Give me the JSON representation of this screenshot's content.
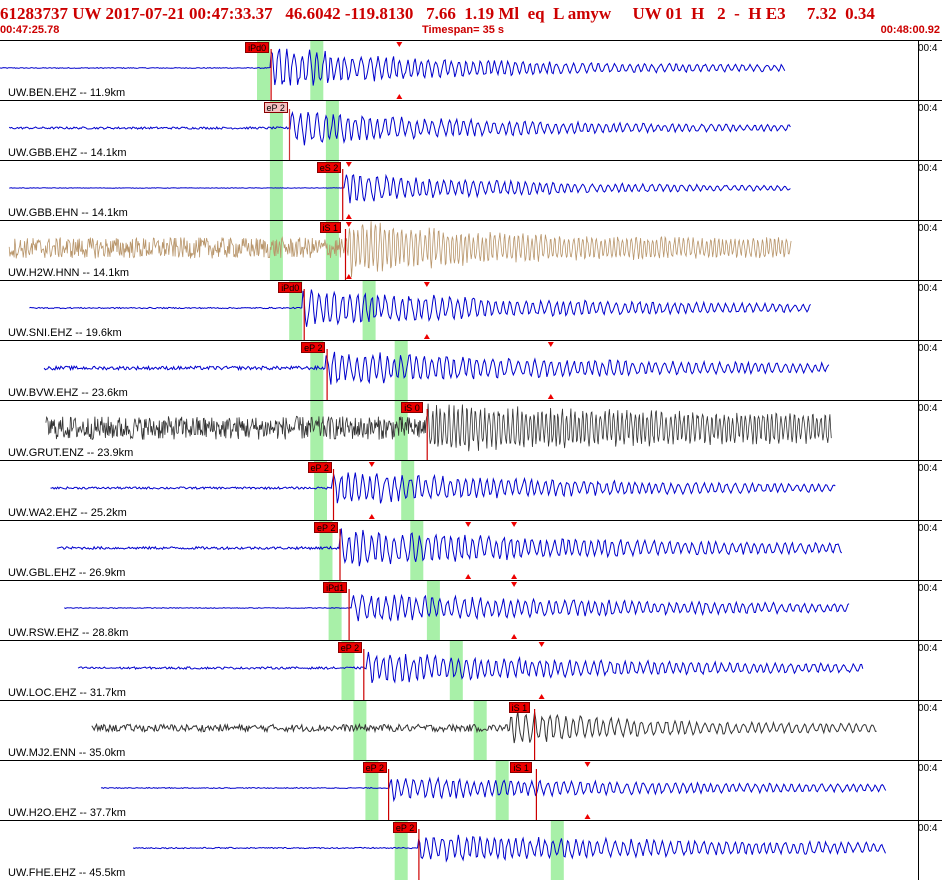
{
  "header": {
    "event_line": "61283737 UW 2017-07-21 00:47:33.37   46.6042 -119.8130   7.66  1.19 Ml  eq  L amyw     UW 01  H   2  -  H E3     7.32  0.34",
    "start_time": "00:47:25.78",
    "timespan": "Timespan=  35 s",
    "end_time": "00:48:00.92"
  },
  "colors": {
    "header_text": "#cc0000",
    "trace_blue": "#0000cc",
    "trace_tan": "#b8956a",
    "trace_gray": "#333333",
    "pick_red": "#ee0000",
    "pick_pale": "#f5c0c0",
    "window_green": "#a8f0a8"
  },
  "right_time_tag": "00:4",
  "channels": [
    {
      "label": "UW.BEN.EHZ -- 11.9km",
      "color": "blue",
      "gain": 0.85,
      "start": 0.0,
      "end": 0.855,
      "noise": 0.02,
      "onset": 0.295,
      "amp": 0.9,
      "decay": 0.35,
      "pick": {
        "text": "iPd0",
        "x": 0.267,
        "pale": false
      },
      "green": [
        0.28,
        0.338
      ],
      "markers": [
        0.435
      ]
    },
    {
      "label": "UW.GBB.EHZ -- 14.1km",
      "color": "blue",
      "gain": 0.7,
      "start": 0.01,
      "end": 0.862,
      "noise": 0.06,
      "onset": 0.316,
      "amp": 0.9,
      "decay": 0.4,
      "pick": {
        "text": "eP 2",
        "x": 0.287,
        "pale": true
      },
      "green": [
        0.294,
        0.355
      ],
      "markers": []
    },
    {
      "label": "UW.GBB.EHN -- 14.1km",
      "color": "blue",
      "gain": 0.6,
      "start": 0.01,
      "end": 0.862,
      "noise": 0.015,
      "onset": 0.376,
      "amp": 0.9,
      "decay": 0.4,
      "pick": {
        "text": "eS 2",
        "x": 0.345,
        "pale": false
      },
      "green": [
        0.294,
        0.355
      ],
      "markers": [
        0.38
      ]
    },
    {
      "label": "UW.H2W.HNN -- 14.1km",
      "color": "tan",
      "gain": 0.9,
      "start": 0.01,
      "end": 0.862,
      "noise": 0.45,
      "onset": 0.38,
      "amp": 0.95,
      "decay": 0.25,
      "pick": {
        "text": "iS 1",
        "x": 0.348,
        "pale": false
      },
      "green": [
        0.294,
        0.355
      ],
      "markers": [
        0.38
      ]
    },
    {
      "label": "UW.SNI.EHZ -- 19.6km",
      "color": "blue",
      "gain": 0.8,
      "start": 0.032,
      "end": 0.883,
      "noise": 0.03,
      "onset": 0.33,
      "amp": 0.9,
      "decay": 0.45,
      "pick": {
        "text": "iPd0",
        "x": 0.303,
        "pale": false
      },
      "green": [
        0.315,
        0.395
      ],
      "markers": [
        0.465
      ]
    },
    {
      "label": "UW.BVW.EHZ -- 23.6km",
      "color": "blue",
      "gain": 0.7,
      "start": 0.048,
      "end": 0.904,
      "noise": 0.1,
      "onset": 0.355,
      "amp": 0.9,
      "decay": 0.6,
      "pick": {
        "text": "eP 2",
        "x": 0.328,
        "pale": false
      },
      "green": [
        0.338,
        0.43
      ],
      "markers": [
        0.6
      ]
    },
    {
      "label": "UW.GRUT.ENZ -- 23.9km",
      "color": "gray",
      "gain": 0.9,
      "start": 0.05,
      "end": 0.906,
      "noise": 0.5,
      "onset": 0.465,
      "amp": 0.6,
      "decay": 0.8,
      "pick": {
        "text": "iS 0",
        "x": 0.437,
        "pale": false
      },
      "green": [
        0.338,
        0.43
      ],
      "markers": []
    },
    {
      "label": "UW.WA2.EHZ -- 25.2km",
      "color": "blue",
      "gain": 0.7,
      "start": 0.055,
      "end": 0.91,
      "noise": 0.06,
      "onset": 0.362,
      "amp": 0.9,
      "decay": 0.5,
      "pick": {
        "text": "eP 2",
        "x": 0.335,
        "pale": false
      },
      "green": [
        0.342,
        0.437
      ],
      "markers": [
        0.405
      ]
    },
    {
      "label": "UW.GBL.EHZ -- 26.9km",
      "color": "blue",
      "gain": 0.75,
      "start": 0.062,
      "end": 0.918,
      "noise": 0.07,
      "onset": 0.37,
      "amp": 0.95,
      "decay": 0.55,
      "pick": {
        "text": "eP 2",
        "x": 0.342,
        "pale": false
      },
      "green": [
        0.348,
        0.447
      ],
      "markers": [
        0.51,
        0.56
      ]
    },
    {
      "label": "UW.RSW.EHZ -- 28.8km",
      "color": "blue",
      "gain": 0.75,
      "start": 0.07,
      "end": 0.926,
      "noise": 0.02,
      "onset": 0.383,
      "amp": 0.7,
      "decay": 0.6,
      "pick": {
        "text": "iPd1",
        "x": 0.352,
        "pale": false
      },
      "green": [
        0.358,
        0.465
      ],
      "markers": [
        0.56
      ]
    },
    {
      "label": "UW.LOC.EHZ -- 31.7km",
      "color": "blue",
      "gain": 0.7,
      "start": 0.085,
      "end": 0.94,
      "noise": 0.06,
      "onset": 0.4,
      "amp": 0.8,
      "decay": 0.55,
      "pick": {
        "text": "eP 2",
        "x": 0.368,
        "pale": false
      },
      "green": [
        0.372,
        0.49
      ],
      "markers": [
        0.59
      ]
    },
    {
      "label": "UW.MJ2.ENN -- 35.0km",
      "color": "gray",
      "gain": 0.7,
      "start": 0.1,
      "end": 0.955,
      "noise": 0.2,
      "onset": 0.555,
      "amp": 0.85,
      "decay": 0.35,
      "pick": {
        "text": "iS 1",
        "x": 0.554,
        "pale": false
      },
      "green": [
        0.385,
        0.516
      ],
      "markers": []
    },
    {
      "label": "UW.H2O.EHZ -- 37.7km",
      "color": "blue",
      "gain": 0.6,
      "start": 0.11,
      "end": 0.965,
      "noise": 0.03,
      "onset": 0.425,
      "amp": 0.7,
      "decay": 0.6,
      "pick": {
        "text": "eP 2",
        "x": 0.395,
        "pale": false
      },
      "secondary": {
        "text": "iS 1",
        "x": 0.556
      },
      "green": [
        0.398,
        0.54
      ],
      "markers": [
        0.64
      ]
    },
    {
      "label": "UW.FHE.EHZ -- 45.5km",
      "color": "blue",
      "gain": 0.6,
      "start": 0.145,
      "end": 0.965,
      "noise": 0.04,
      "onset": 0.455,
      "amp": 0.85,
      "decay": 0.8,
      "pick": {
        "text": "eP 2",
        "x": 0.428,
        "pale": false
      },
      "green": [
        0.43,
        0.6
      ],
      "markers": []
    }
  ]
}
